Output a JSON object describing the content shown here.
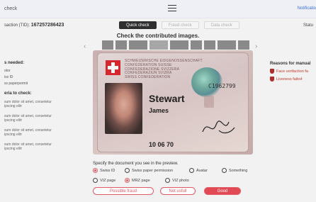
{
  "header": {
    "title": "check",
    "notifications_label": "Notificatio"
  },
  "transaction": {
    "label": "saction (TID):",
    "id": "167257286423"
  },
  "status_label": "Statu",
  "tabs": [
    "Quick check",
    "Fraud check",
    "Data check"
  ],
  "active_tab": "Quick check",
  "heading": "Check the contributed images.",
  "sidebar": {
    "needed_title": "s needed:",
    "needed_items": [
      "otor",
      "iss ID",
      "ss paperpermit"
    ],
    "criteria_title": "eria to check:",
    "criteria_items": [
      "sum dolor sit amet, consetetur\nipscing elitr",
      "sum dolor sit amet, consetetur\nipscing elitr",
      "sum dolor sit amet, consetetur\nipscing elitr",
      "sum dolor sit amet, consetetur\nipscing elitr"
    ]
  },
  "reasons": {
    "title": "Reasons for manual",
    "items": [
      "Face verifaction fa",
      "Liveness failed"
    ]
  },
  "document": {
    "header_lines": "SCHWEIZERISCHE EIDGENOSSENSCHAFT\nCONFÉDÉRATION SUISSE\nCONFEDERAZIONE SVIZZERA\nCONFEDERAZIUN SVIZRA\nSWISS CONFEDERATION",
    "doc_number": "C1962799",
    "surname": "Stewart",
    "given_name": "James",
    "dob": "10 06 70",
    "flag_color": "#d6272e"
  },
  "selection": {
    "prompt": "Specify the document you see in the preview.",
    "options_row1": [
      {
        "label": "Swiss ID",
        "selected": true
      },
      {
        "label": "Swiss paper permission",
        "selected": false
      },
      {
        "label": "Avatar",
        "selected": false
      },
      {
        "label": "Something",
        "selected": false
      }
    ],
    "options_row2": [
      {
        "label": "VIZ page",
        "selected": false
      },
      {
        "label": "MRZ page",
        "selected": true
      },
      {
        "label": "VIZ photo",
        "selected": false
      }
    ]
  },
  "actions": {
    "fraud": "Possible fraud",
    "not_useful": "Not usfull",
    "good": "Good"
  },
  "colors": {
    "accent": "#e14a55",
    "dark_tab": "#2f2f2f",
    "link": "#3b6fd8"
  }
}
